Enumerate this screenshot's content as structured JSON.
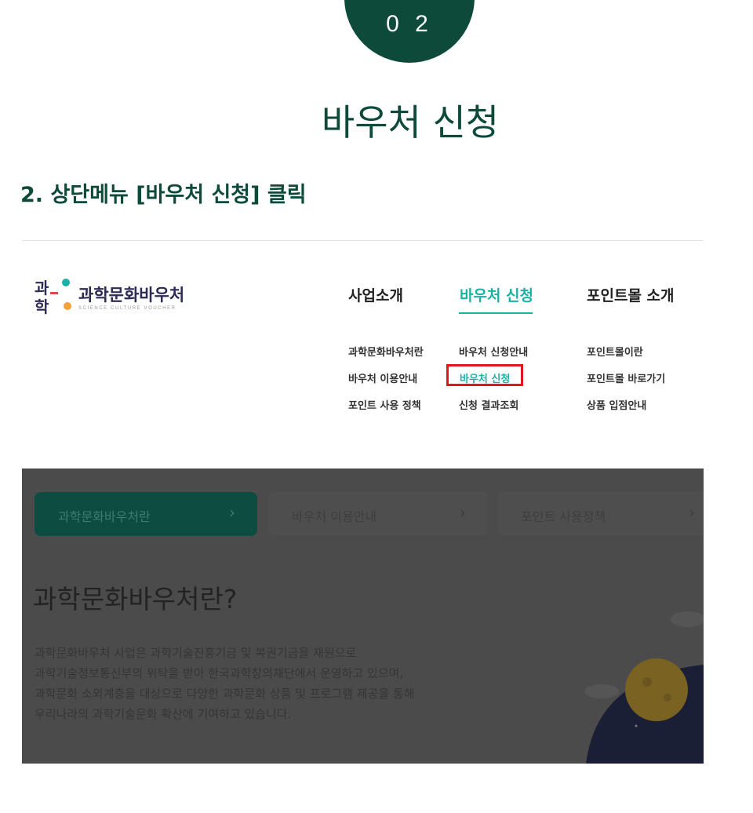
{
  "step": {
    "number": "0 2"
  },
  "title": "바우처 신청",
  "subtitle": "2. 상단메뉴 [바우처 신청] 클릭",
  "logo": {
    "name": "과학문화바우처",
    "tagline": "SCIENCE CULTURE VOUCHER",
    "mark_text": "과학"
  },
  "nav": {
    "menus": [
      {
        "label": "사업소개",
        "items": [
          "과학문화바우처란",
          "바우처 이용안내",
          "포인트 사용 정책"
        ]
      },
      {
        "label": "바우처 신청",
        "active": true,
        "items": [
          "바우처 신청안내",
          "바우처 신청",
          "신청 결과조회"
        ]
      },
      {
        "label": "포인트몰 소개",
        "items": [
          "포인트몰이란",
          "포인트몰 바로가기",
          "상품 입점안내"
        ]
      }
    ],
    "highlighted_item": "바우처 신청"
  },
  "panel": {
    "tabs": [
      "과학문화바우처란",
      "바우처 이용안내",
      "포인트 사용정책"
    ],
    "active_tab": "과학문화바우처란",
    "heading": "과학문화바우처란?",
    "body_lines": [
      "과학문화바우처 사업은 과학기술진흥기금 및 복권기금을 재원으로",
      "과학기술정보통신부의 위탁을 받아 한국과학창의재단에서 운영하고 있으며,",
      "과학문화 소외계층을 대상으로 다양한 과학문화 상품 및 프로그램 제공을 통해",
      "우리나라의 과학기술문화 확산에 기여하고 있습니다."
    ]
  },
  "colors": {
    "brand": "#0d4a3a",
    "accent": "#19b2a6",
    "highlight": "#e3161b",
    "overlay": "#4b4b4b"
  },
  "icons": [
    "chevron-right-icon",
    "planet-illustration"
  ]
}
